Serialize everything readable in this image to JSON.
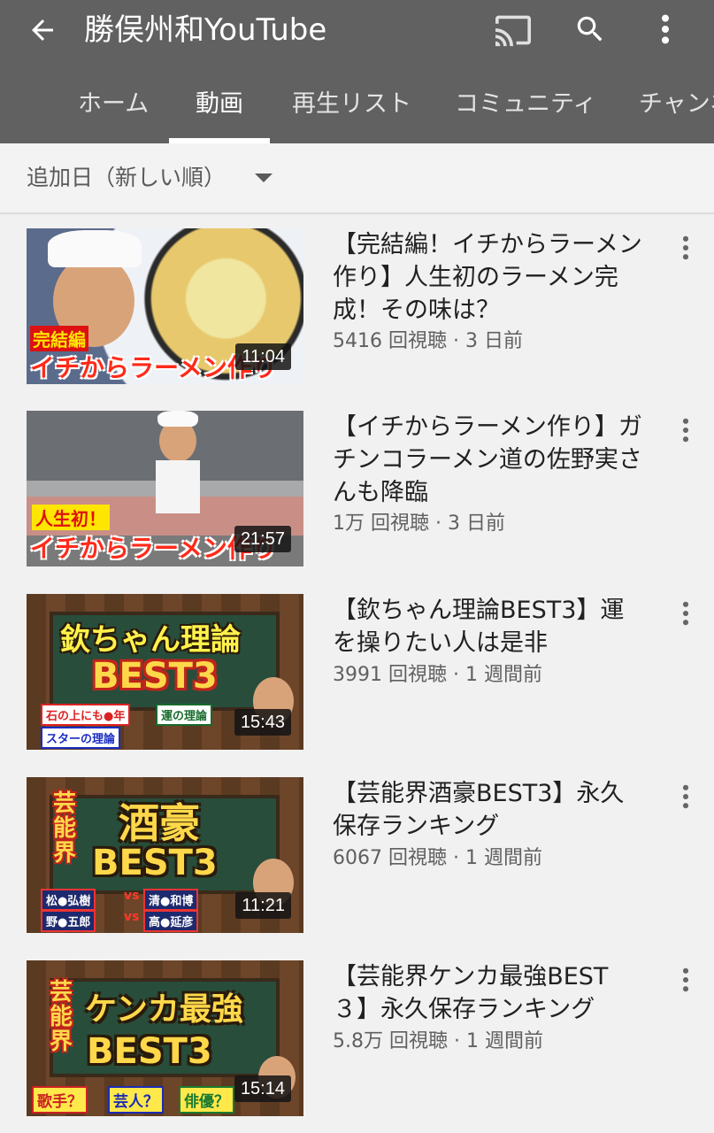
{
  "appbar": {
    "title": "勝俣州和YouTube",
    "icons": [
      "back-arrow-icon",
      "cast-icon",
      "search-icon",
      "more-vert-icon"
    ]
  },
  "tabs": [
    {
      "label": "ホーム",
      "active": false
    },
    {
      "label": "動画",
      "active": true
    },
    {
      "label": "再生リスト",
      "active": false
    },
    {
      "label": "コミュニティ",
      "active": false
    },
    {
      "label": "チャンネル",
      "active": false
    }
  ],
  "sort": {
    "label": "追加日（新しい順）"
  },
  "videos": [
    {
      "title": "【完結編！イチからラーメン作り】人生初のラーメン完成！その味は？",
      "meta": "5416 回視聴 · 3 日前",
      "duration": "11:04",
      "thumb_caption_1": "完結編",
      "thumb_caption_2": "イチからラーメン作り"
    },
    {
      "title": "【イチからラーメン作り】ガチンコラーメン道の佐野実さんも降臨",
      "meta": "1万 回視聴 · 3 日前",
      "duration": "21:57",
      "thumb_caption_1": "人生初！",
      "thumb_caption_2": "イチからラーメン作り"
    },
    {
      "title": "【欽ちゃん理論BEST3】運を操りたい人は是非",
      "meta": "3991 回視聴 · 1 週間前",
      "duration": "15:43",
      "thumb_caption_1": "欽ちゃん理論",
      "thumb_caption_2": "BEST3",
      "thumb_chips": [
        "石の上にも●年",
        "運の理論",
        "スターの理論"
      ]
    },
    {
      "title": "【芸能界酒豪BEST3】永久保存ランキング",
      "meta": "6067 回視聴 · 1 週間前",
      "duration": "11:21",
      "thumb_caption_1": "芸能界",
      "thumb_caption_2": "酒豪",
      "thumb_caption_3": "BEST3",
      "thumb_chips": [
        "松●弘樹",
        "清●和博",
        "野●五郎",
        "高●延彦"
      ],
      "thumb_vs": "vs"
    },
    {
      "title": "【芸能界ケンカ最強BEST３】永久保存ランキング",
      "meta": "5.8万 回視聴 · 1 週間前",
      "duration": "15:14",
      "thumb_caption_1": "芸能界",
      "thumb_caption_2": "ケンカ最強",
      "thumb_caption_3": "BEST3",
      "thumb_chips": [
        "歌手？",
        "芸人？",
        "俳優？"
      ]
    }
  ]
}
